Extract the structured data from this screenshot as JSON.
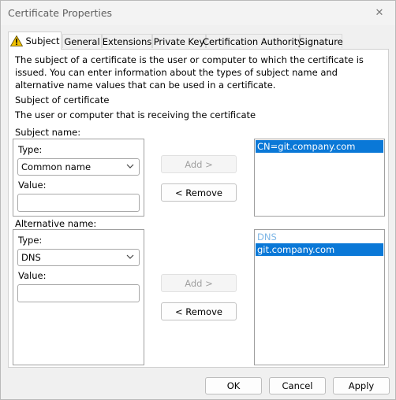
{
  "window": {
    "title": "Certificate Properties",
    "close_glyph": "✕"
  },
  "tabs": [
    "Subject",
    "General",
    "Extensions",
    "Private Key",
    "Certification Authority",
    "Signature"
  ],
  "intro_text": "The subject of a certificate is the user or computer to which the certificate is issued. You can enter information about the types of subject name and alternative name values that can be used in a certificate.",
  "subject_heading": "Subject of certificate",
  "subject_desc": "The user or computer that is receiving the certificate",
  "subject_name": {
    "label": "Subject name:",
    "type_label": "Type:",
    "type_value": "Common name",
    "value_label": "Value:",
    "value_text": ""
  },
  "alternative_name": {
    "label": "Alternative name:",
    "type_label": "Type:",
    "type_value": "DNS",
    "value_label": "Value:",
    "value_text": ""
  },
  "buttons": {
    "add": "Add >",
    "remove": "< Remove",
    "ok": "OK",
    "cancel": "Cancel",
    "apply": "Apply"
  },
  "subject_list": [
    "CN=git.company.com"
  ],
  "alt_list": {
    "header": "DNS",
    "items": [
      "git.company.com"
    ]
  },
  "colors": {
    "selection": "#0a78d7",
    "warning": "#f2c200"
  },
  "icons": {
    "tab_warning": "warning-triangle-icon",
    "dropdown": "chevron-down-icon"
  }
}
